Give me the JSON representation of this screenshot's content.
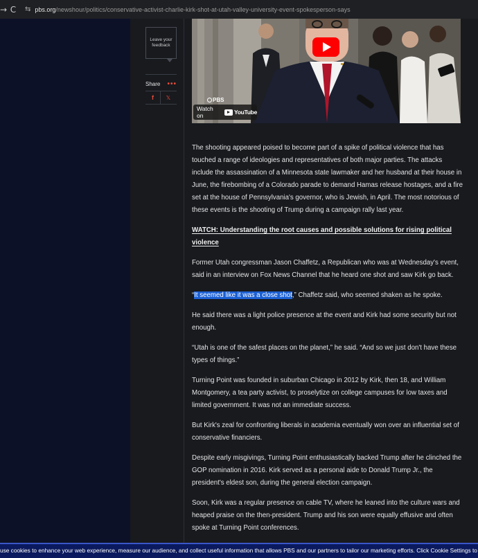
{
  "browser": {
    "back_glyph": "→",
    "reload_glyph": "C",
    "site_icon": "⇆",
    "url_domain": "pbs.org",
    "url_path": "/newshour/politics/conservative-activist-charlie-kirk-shot-at-utah-valley-university-event-spokesperson-says"
  },
  "sidebar": {
    "feedback_label": "Leave your feedback",
    "share_label": "Share",
    "share_more": "•••",
    "facebook_glyph": "f",
    "x_glyph": "𝕏"
  },
  "video": {
    "pbs_label": "PBS",
    "watch_on": "Watch on",
    "youtube_label": "YouTube"
  },
  "article": {
    "p1": "The shooting appeared poised to become part of a spike of political violence that has touched a range of ideologies and representatives of both major parties. The attacks include the assassination of a Minnesota state lawmaker and her husband at their house in June, the firebombing of a Colorado parade to demand Hamas release hostages, and a fire set at the house of Pennsylvania's governor, who is Jewish, in April. The most notorious of these events is the shooting of Trump during a campaign rally last year.",
    "watch_link": "WATCH: Understanding the root causes and possible solutions for rising political violence",
    "p2": "Former Utah congressman Jason Chaffetz, a Republican who was at Wednesday's event, said in an interview on Fox News Channel that he heard one shot and saw Kirk go back.",
    "p3_open": "“",
    "p3_highlight": "It seemed like it was a close shot",
    "p3_rest": ",” Chaffetz said, who seemed shaken as he spoke.",
    "p4": "He said there was a light police presence at the event and Kirk had some security but not enough.",
    "p5": "“Utah is one of the safest places on the planet,” he said. “And so we just don't have these types of things.”",
    "p6": "Turning Point was founded in suburban Chicago in 2012 by Kirk, then 18, and William Montgomery, a tea party activist, to proselytize on college campuses for low taxes and limited government. It was not an immediate success.",
    "p7": "But Kirk's zeal for confronting liberals in academia eventually won over an influential set of conservative financiers.",
    "p8": "Despite early misgivings, Turning Point enthusiastically backed Trump after he clinched the GOP nomination in 2016. Kirk served as a personal aide to Donald Trump Jr., the president's eldest son, during the general election campaign.",
    "p9": "Soon, Kirk was a regular presence on cable TV, where he leaned into the culture wars and heaped praise on the then-president. Trump and his son were equally effusive and often spoke at Turning Point conferences."
  },
  "cookie_banner": {
    "text": "use cookies to enhance your web experience, measure our audience, and collect useful information that allows PBS and our partners to tailor our marketing efforts. Click Cookie Settings to set your preferen"
  },
  "colors": {
    "accent_red": "#e64a3b",
    "highlight_blue": "#1a5fd4",
    "cookie_bg": "#0b1a5e",
    "youtube_red": "#ff0000"
  }
}
